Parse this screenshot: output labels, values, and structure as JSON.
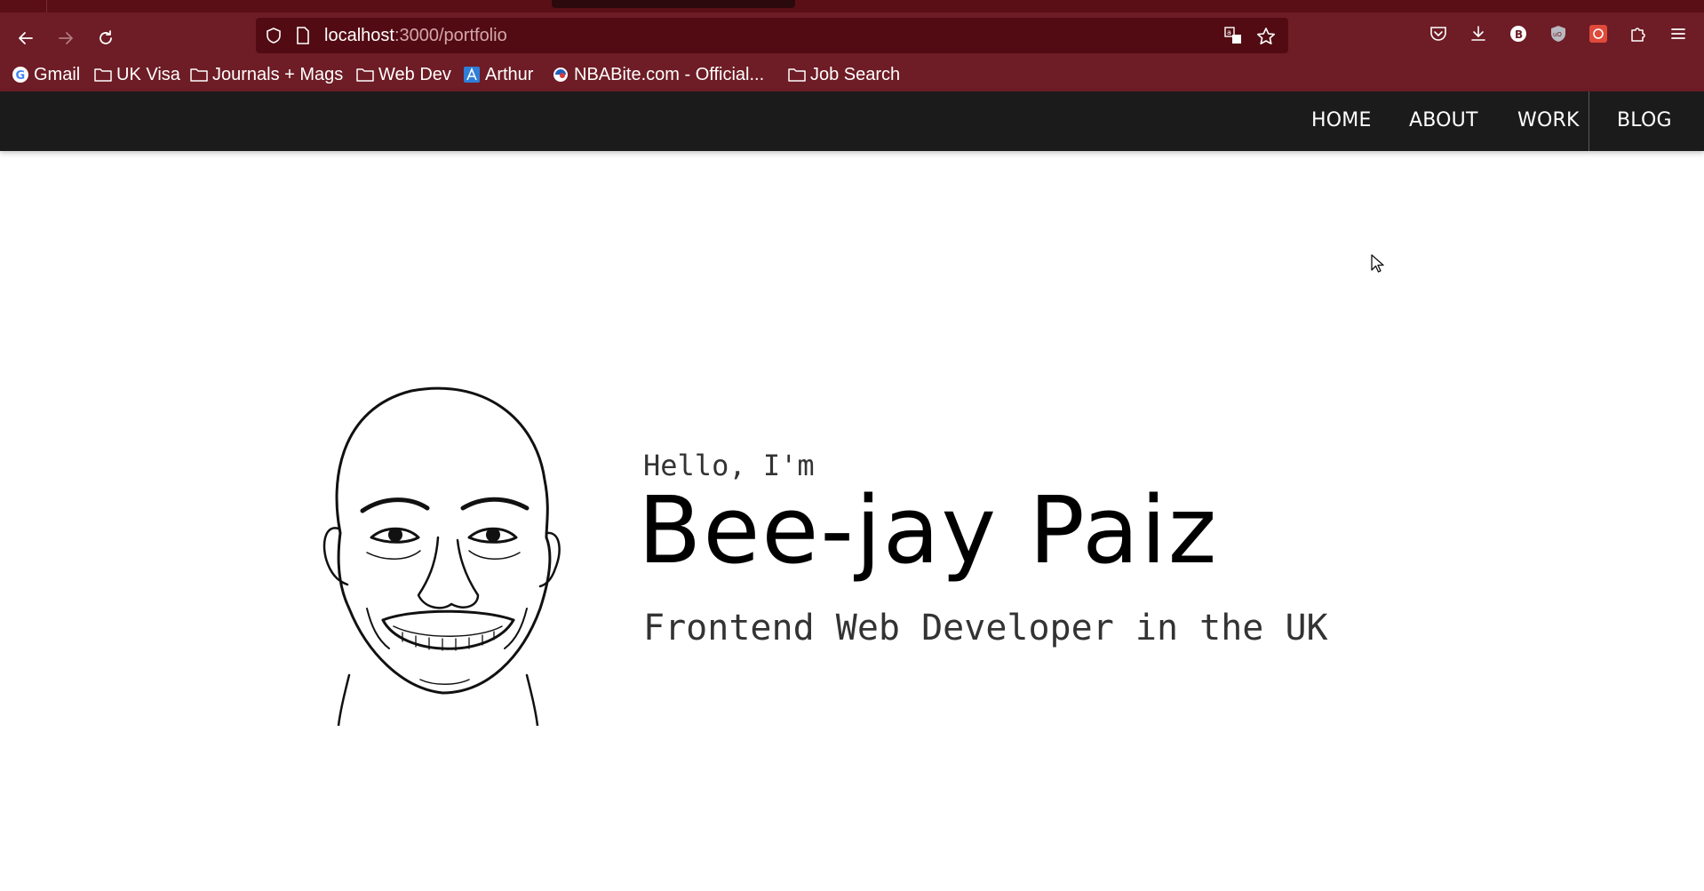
{
  "browser": {
    "url_host": "localhost",
    "url_path": ":3000/portfolio",
    "icons": [
      "back-icon",
      "forward-icon",
      "reload-icon",
      "shield-icon",
      "page-icon",
      "translate-icon",
      "star-icon",
      "pocket-icon",
      "download-icon",
      "extension-b-icon",
      "ublock-icon",
      "extension-red-icon",
      "puzzle-icon",
      "menu-icon"
    ],
    "bookmarks": [
      {
        "label": "Gmail",
        "icon": "google-icon"
      },
      {
        "label": "UK Visa",
        "icon": "folder-icon"
      },
      {
        "label": "Journals + Mags",
        "icon": "folder-icon"
      },
      {
        "label": "Web Dev",
        "icon": "folder-icon"
      },
      {
        "label": "Arthur",
        "icon": "arthur-icon"
      },
      {
        "label": "NBABite.com - Official...",
        "icon": "nbabite-icon"
      },
      {
        "label": "Job Search",
        "icon": "folder-icon"
      }
    ]
  },
  "site_nav": {
    "home": "HOME",
    "about": "ABOUT",
    "work": "WORK",
    "blog": "BLOG"
  },
  "hero": {
    "greeting": "Hello, I'm",
    "name": "Bee-jay Paiz",
    "subtitle": "Frontend Web Developer in the UK"
  },
  "colors": {
    "chrome": "#6e1c25",
    "urlbar": "#520b12",
    "nav_bg": "#1b1b1b"
  }
}
